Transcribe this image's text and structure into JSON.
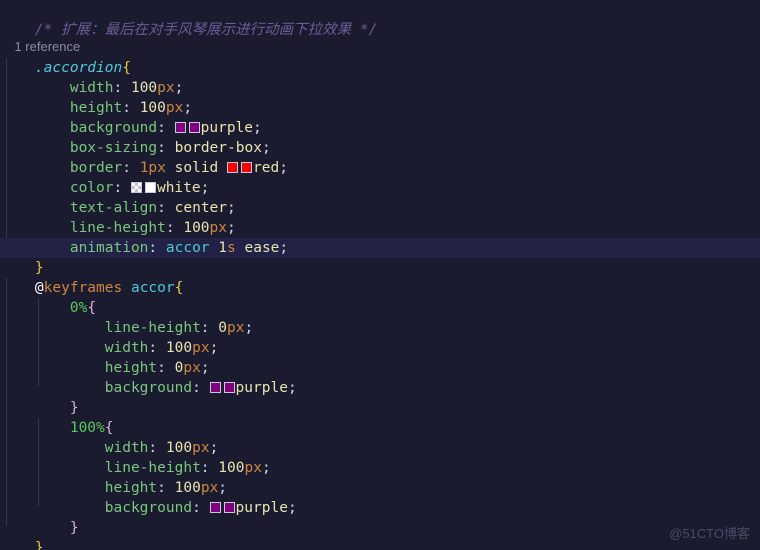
{
  "editor": {
    "language": "css",
    "theme_background": "#1b1b2f",
    "current_line_background": "#222247",
    "indent_guide_color": "#3a3a5c"
  },
  "codelens": {
    "reference_label": "1 reference"
  },
  "comment": {
    "text": "/* 扩展：最后在对手风琴展示进行动画下拉效果 */"
  },
  "rule_accordion": {
    "selector": ".accordion",
    "open_brace": "{",
    "close_brace": "}",
    "declarations": [
      {
        "property": "width",
        "colon": ": ",
        "value": "100",
        "unit": "px",
        "semi": ";"
      },
      {
        "property": "height",
        "colon": ": ",
        "value": "100",
        "unit": "px",
        "semi": ";"
      },
      {
        "property": "background",
        "colon": ": ",
        "value": "purple",
        "swatch": "purple",
        "semi": ";"
      },
      {
        "property": "box-sizing",
        "colon": ": ",
        "value": "border-box",
        "semi": ";"
      },
      {
        "property": "border",
        "colon": ": ",
        "value": "1px solid red",
        "swatch": "red",
        "semi": ";"
      },
      {
        "property": "color",
        "colon": ": ",
        "value": "white",
        "swatch": "white",
        "semi": ";"
      },
      {
        "property": "text-align",
        "colon": ": ",
        "value": "center",
        "semi": ";"
      },
      {
        "property": "line-height",
        "colon": ": ",
        "value": "100",
        "unit": "px",
        "semi": ";"
      },
      {
        "property": "animation",
        "colon": ": ",
        "value": "accor 1s ease",
        "semi": ";"
      }
    ]
  },
  "rule_keyframes": {
    "at_symbol": "@",
    "at_rule": "keyframes",
    "name": "accor",
    "open_brace": "{",
    "close_brace": "}",
    "frames": [
      {
        "stop": "0%",
        "open_brace": "{",
        "close_brace": "}",
        "declarations": [
          {
            "property": "line-height",
            "colon": ": ",
            "value": "0",
            "unit": "px",
            "semi": ";"
          },
          {
            "property": "width",
            "colon": ": ",
            "value": "100",
            "unit": "px",
            "semi": ";"
          },
          {
            "property": "height",
            "colon": ": ",
            "value": "0",
            "unit": "px",
            "semi": ";"
          },
          {
            "property": "background",
            "colon": ": ",
            "value": "purple",
            "swatch": "purple",
            "semi": ";"
          }
        ]
      },
      {
        "stop": "100%",
        "open_brace": "{",
        "close_brace": "}",
        "declarations": [
          {
            "property": "width",
            "colon": ": ",
            "value": "100",
            "unit": "px",
            "semi": ";"
          },
          {
            "property": "line-height",
            "colon": ": ",
            "value": "100",
            "unit": "px",
            "semi": ";"
          },
          {
            "property": "height",
            "colon": ": ",
            "value": "100",
            "unit": "px",
            "semi": ";"
          },
          {
            "property": "background",
            "colon": ": ",
            "value": "purple",
            "swatch": "purple",
            "semi": ";"
          }
        ]
      }
    ]
  },
  "tokens": {
    "colon": ": ",
    "space": " ",
    "solid": "solid",
    "one_px": "1px",
    "red_word": "red",
    "white_word": "white",
    "purple_word": "purple",
    "border_box": "border-box",
    "center": "center",
    "accor_ident": "accor",
    "one": "1",
    "s_unit": "s",
    "ease": "ease",
    "semi": ";"
  },
  "swatch_colors": {
    "purple": "#800080",
    "red": "#ff0000",
    "white": "#ffffff",
    "swatch_border": "#c8c8d8"
  },
  "watermark": {
    "text": "@51CTO博客"
  }
}
